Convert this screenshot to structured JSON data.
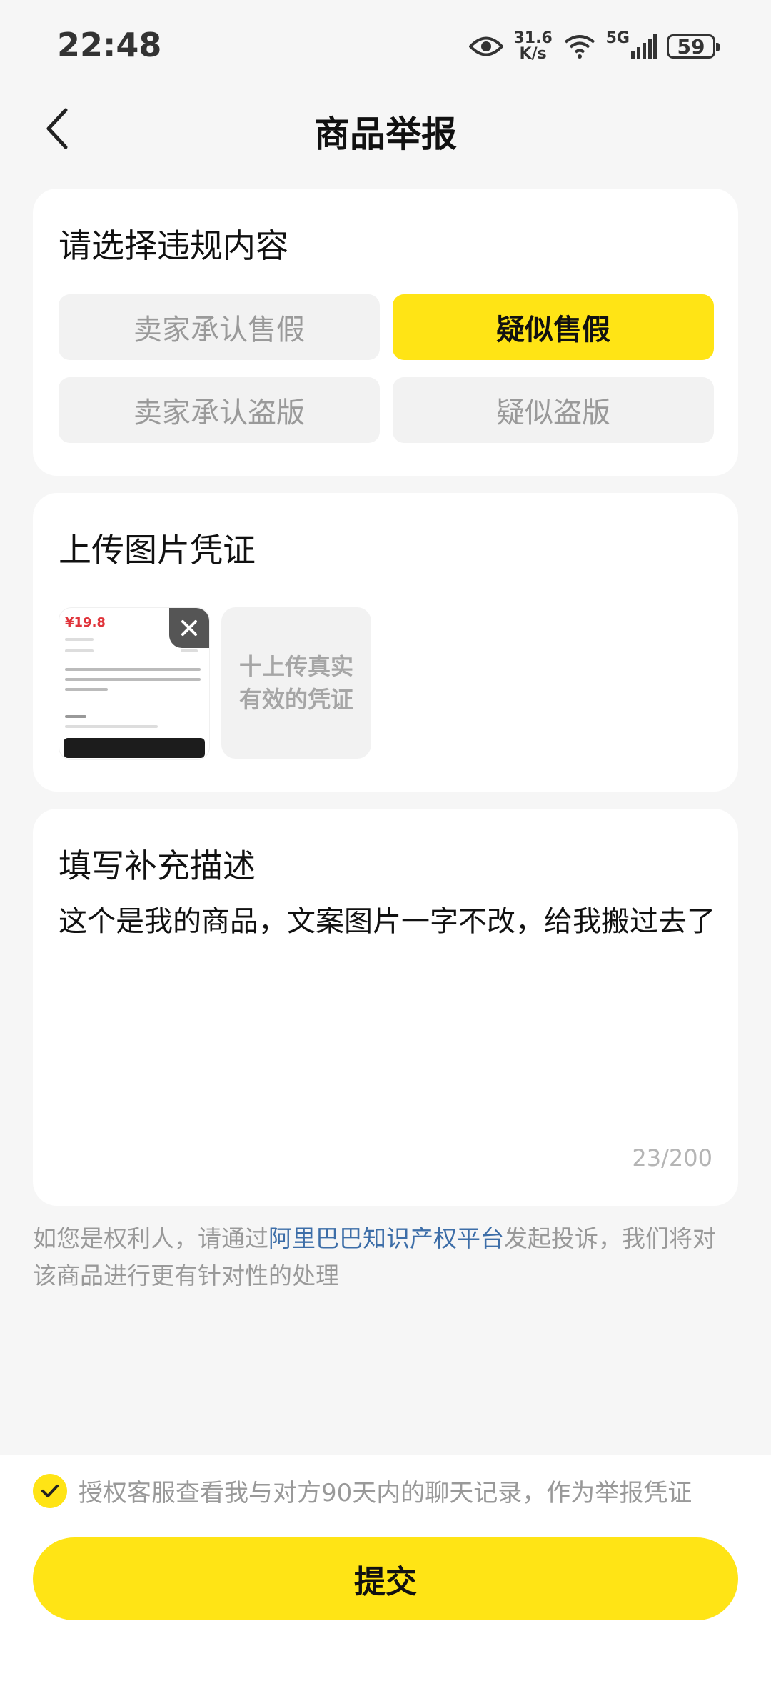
{
  "status_bar": {
    "time": "22:48",
    "speed_value": "31.6",
    "speed_unit": "K/s",
    "network": "5G",
    "battery": "59"
  },
  "header": {
    "title": "商品举报",
    "back_icon": "chevron-left-icon"
  },
  "violation": {
    "title": "请选择违规内容",
    "options": [
      {
        "label": "卖家承认售假",
        "selected": false
      },
      {
        "label": "疑似售假",
        "selected": true
      },
      {
        "label": "卖家承认盗版",
        "selected": false
      },
      {
        "label": "疑似盗版",
        "selected": false
      }
    ]
  },
  "upload": {
    "title": "上传图片凭证",
    "thumb_price": "¥19.8",
    "upload_line1": "十上传真实",
    "upload_line2": "有效的凭证"
  },
  "description": {
    "title": "填写补充描述",
    "text": "这个是我的商品，文案图片一字不改，给我搬过去了",
    "counter": "23/200"
  },
  "notice": {
    "prefix": "如您是权利人，请通过",
    "link": "阿里巴巴知识产权平台",
    "suffix": "发起投诉，我们将对该商品进行更有针对性的处理"
  },
  "consent": {
    "text": "授权客服查看我与对方90天内的聊天记录，作为举报凭证",
    "checked": true
  },
  "submit_label": "提交",
  "colors": {
    "accent": "#ffe415",
    "link": "#3d6ea8",
    "background": "#f6f6f6"
  }
}
